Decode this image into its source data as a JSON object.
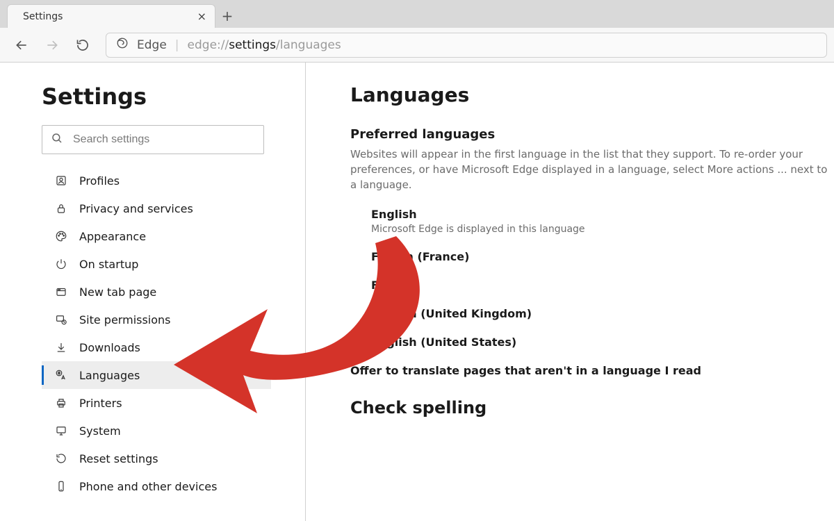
{
  "tab": {
    "title": "Settings"
  },
  "toolbar": {
    "product": "Edge",
    "url_seg1": "edge://",
    "url_seg2": "settings",
    "url_seg3": "/languages"
  },
  "sidebar": {
    "title": "Settings",
    "search_placeholder": "Search settings",
    "items": [
      {
        "label": "Profiles",
        "icon": "profile-icon",
        "active": false
      },
      {
        "label": "Privacy and services",
        "icon": "lock-icon",
        "active": false
      },
      {
        "label": "Appearance",
        "icon": "palette-icon",
        "active": false
      },
      {
        "label": "On startup",
        "icon": "power-icon",
        "active": false
      },
      {
        "label": "New tab page",
        "icon": "newtab-icon",
        "active": false
      },
      {
        "label": "Site permissions",
        "icon": "permissions-icon",
        "active": false
      },
      {
        "label": "Downloads",
        "icon": "download-icon",
        "active": false
      },
      {
        "label": "Languages",
        "icon": "languages-icon",
        "active": true
      },
      {
        "label": "Printers",
        "icon": "printer-icon",
        "active": false
      },
      {
        "label": "System",
        "icon": "system-icon",
        "active": false
      },
      {
        "label": "Reset settings",
        "icon": "reset-icon",
        "active": false
      },
      {
        "label": "Phone and other devices",
        "icon": "phone-icon",
        "active": false
      }
    ]
  },
  "main": {
    "title": "Languages",
    "preferred": {
      "heading": "Preferred languages",
      "description": "Websites will appear in the first language in the list that they support. To re-order your preferences, or have Microsoft Edge displayed in a language, select More actions ... next to a language.",
      "items": [
        {
          "name": "English",
          "note": "Microsoft Edge is displayed in this language"
        },
        {
          "name": "French (France)",
          "note": ""
        },
        {
          "name": "French",
          "note": ""
        },
        {
          "name": "English (United Kingdom)",
          "note": ""
        },
        {
          "name": "English (United States)",
          "note": ""
        }
      ]
    },
    "translate_toggle_label": "Offer to translate pages that aren't in a language I read",
    "spelling_heading": "Check spelling"
  },
  "annotation": {
    "arrow_color": "#d43329"
  }
}
